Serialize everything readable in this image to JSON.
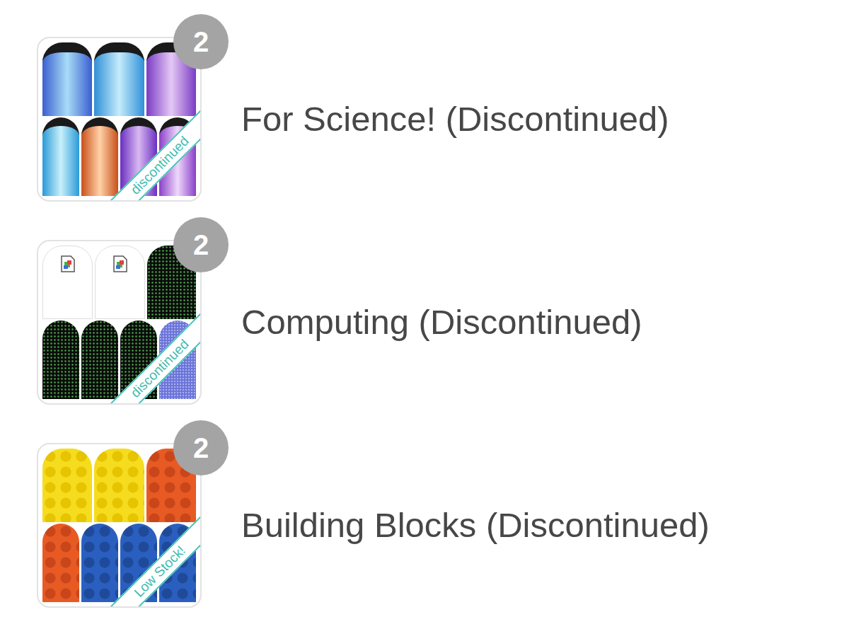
{
  "items": [
    {
      "title": "For Science! (Discontinued)",
      "badge": "2",
      "ribbon": "discontinued",
      "kind": "science"
    },
    {
      "title": "Computing (Discontinued)",
      "badge": "2",
      "ribbon": "discontinued",
      "kind": "computing"
    },
    {
      "title": "Building Blocks (Discontinued)",
      "badge": "2",
      "ribbon": "Low Stock!",
      "kind": "blocks"
    }
  ]
}
